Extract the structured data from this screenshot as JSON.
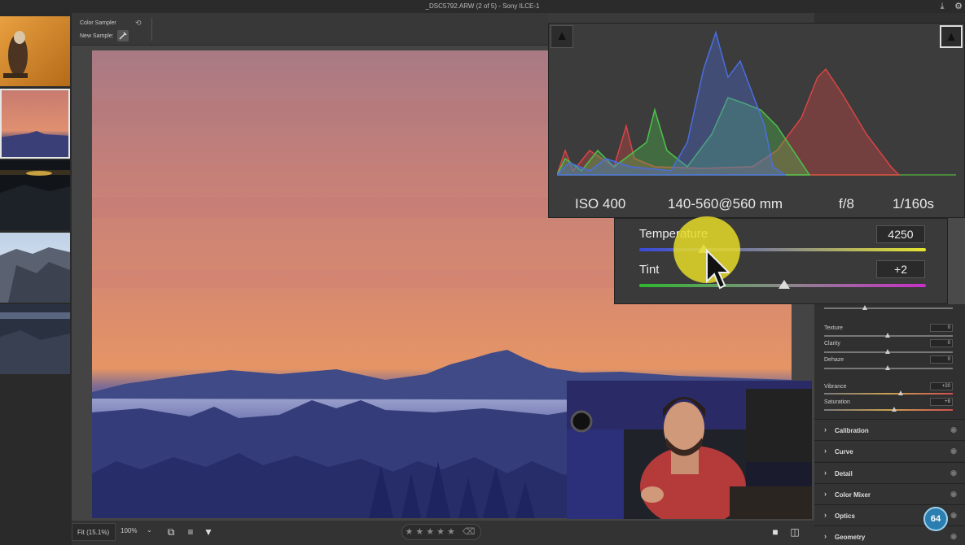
{
  "title_bar": {
    "title": "_DSC5792.ARW (2 of 5) -  Sony ILCE-1"
  },
  "toolbar": {
    "color_sampler_label": "Color Sampler",
    "new_sample_label": "New Sample:"
  },
  "filmstrip": {
    "thumbnails": [
      "hawk",
      "sunset-mountains",
      "night-valley",
      "rocky-peaks",
      "rocky-dusk"
    ],
    "selected_index": 1
  },
  "histogram": {
    "exif": {
      "iso": "ISO 400",
      "lens": "140-560@560 mm",
      "aperture": "f/8",
      "shutter": "1/160s"
    },
    "colors": {
      "red": "#d94545",
      "green": "#4cc24c",
      "blue": "#4a6ee0"
    }
  },
  "white_balance": {
    "temperature_label": "Temperature",
    "temperature_value": "4250",
    "tint_label": "Tint",
    "tint_value": "+2"
  },
  "presence": [
    {
      "label": "Texture",
      "value": "0"
    },
    {
      "label": "Clarity",
      "value": "0"
    },
    {
      "label": "Dehaze",
      "value": "0"
    },
    {
      "label": "Vibrance",
      "value": "+20"
    },
    {
      "label": "Saturation",
      "value": "+8"
    }
  ],
  "sections": [
    "Calibration",
    "Curve",
    "Detail",
    "Color Mixer",
    "Optics",
    "Geometry"
  ],
  "bottom_bar": {
    "fit_label": "Fit (15.1%)",
    "zoom_label": "100%",
    "rating": 0
  },
  "logo_text": "64"
}
